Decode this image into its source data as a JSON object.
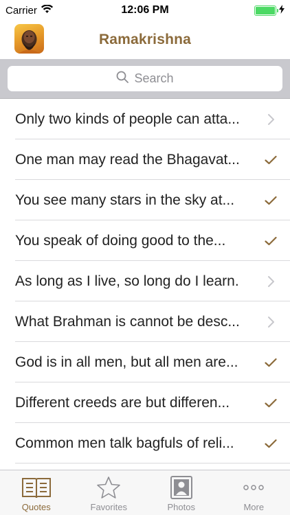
{
  "status_bar": {
    "carrier": "Carrier",
    "time": "12:06 PM",
    "battery_level": 1.0
  },
  "nav": {
    "title": "Ramakrishna",
    "avatar_icon": "portrait-icon"
  },
  "search": {
    "placeholder": "Search"
  },
  "quotes": [
    {
      "text": "Only two kinds of people can atta...",
      "accessory": "chevron"
    },
    {
      "text": "One man may read the Bhagavat...",
      "accessory": "checkmark"
    },
    {
      "text": "You see many stars in the sky at...",
      "accessory": "checkmark"
    },
    {
      "text": "You speak of doing good to the...",
      "accessory": "checkmark"
    },
    {
      "text": "As long as I live, so long do I learn.",
      "accessory": "chevron"
    },
    {
      "text": "What Brahman is cannot be desc...",
      "accessory": "chevron"
    },
    {
      "text": "God is in all men, but all men are...",
      "accessory": "checkmark"
    },
    {
      "text": "Different creeds are but differen...",
      "accessory": "checkmark"
    },
    {
      "text": "Common men talk bagfuls of reli...",
      "accessory": "checkmark"
    }
  ],
  "tabs": [
    {
      "label": "Quotes",
      "icon": "book-icon",
      "active": true
    },
    {
      "label": "Favorites",
      "icon": "star-icon",
      "active": false
    },
    {
      "label": "Photos",
      "icon": "photo-icon",
      "active": false
    },
    {
      "label": "More",
      "icon": "more-icon",
      "active": false
    }
  ],
  "colors": {
    "accent": "#8b6a3a",
    "battery": "#4cd964",
    "inactive": "#8e8e93"
  }
}
